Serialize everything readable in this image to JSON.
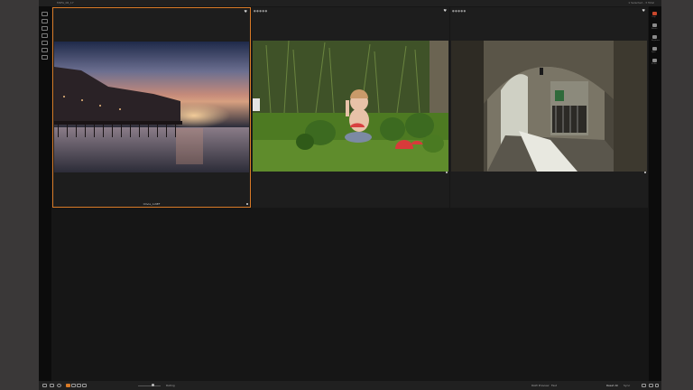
{
  "titlebar": {
    "title": "MSFA_06_17",
    "selection": "1 Selected - 3 Total"
  },
  "variants": [
    {
      "filename": "Olivia_A.NEF",
      "selected": true
    },
    {
      "filename": "",
      "selected": false
    },
    {
      "filename": "",
      "selected": false
    }
  ],
  "thumb_icons": {
    "heart": "♥",
    "stars": "●●●●●"
  },
  "left_tools": [
    "import-icon",
    "folder-icon",
    "library-icon",
    "capture-icon",
    "process-icon",
    "export-icon",
    "layout-icon"
  ],
  "right_tools": [
    {
      "icon": "crop-icon",
      "label": "Crop"
    },
    {
      "icon": "rotate-icon",
      "label": "Rotate"
    },
    {
      "icon": "keystone-icon",
      "label": "Keystone"
    },
    {
      "icon": "spot-icon",
      "label": "Spot"
    },
    {
      "icon": "picker-icon",
      "label": "Picker"
    }
  ],
  "bottombar": {
    "rating_label": "Rating",
    "proof_label": "RAW Preview",
    "proof_value": "Fast",
    "reset_label": "Reset All",
    "sync_label": "Sync"
  },
  "colors": {
    "selection": "#d87a27",
    "background": "#161616",
    "panel": "#1d1d1d"
  }
}
